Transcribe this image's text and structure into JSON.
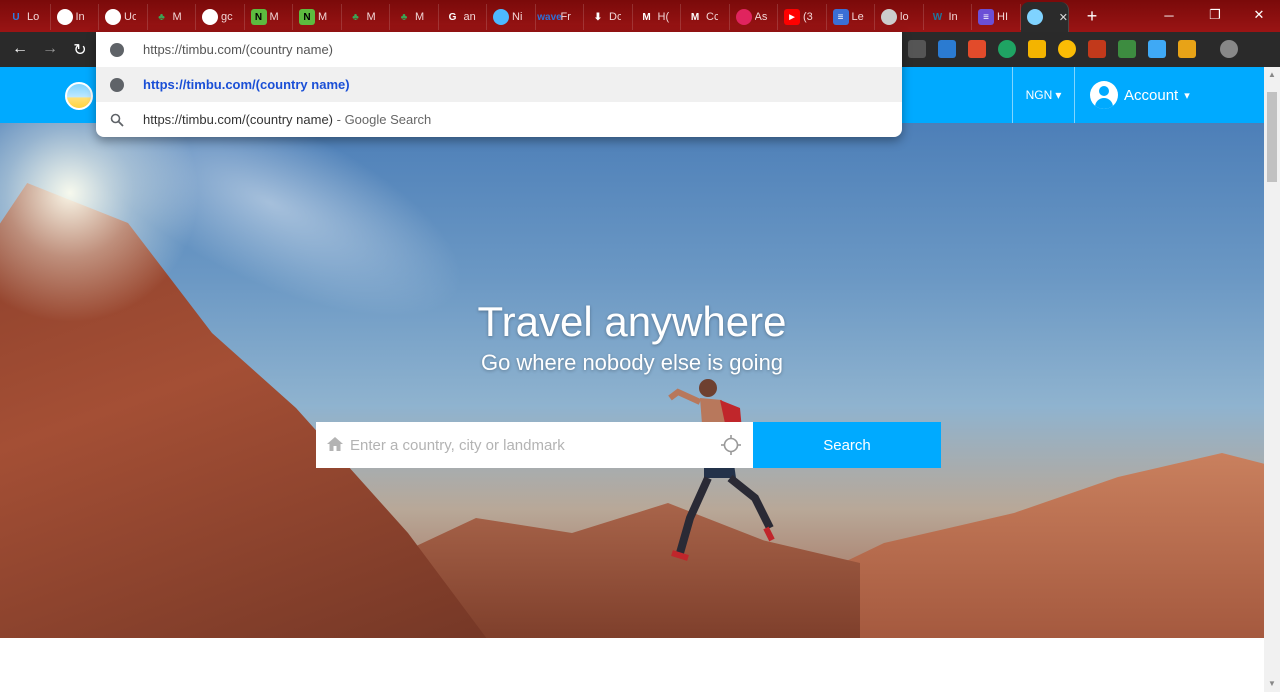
{
  "browser": {
    "tabs": [
      {
        "label": "Lo",
        "icon": "U",
        "color": "#2f7de1"
      },
      {
        "label": "In",
        "icon": "globe",
        "color": "#ffffff"
      },
      {
        "label": "Uc",
        "icon": "globe",
        "color": "#ffffff"
      },
      {
        "label": "M",
        "icon": "leaf",
        "color": "#3aa655"
      },
      {
        "label": "gc",
        "icon": "globe",
        "color": "#ffffff"
      },
      {
        "label": "M",
        "icon": "N",
        "color": "#5dbb3f"
      },
      {
        "label": "M",
        "icon": "N",
        "color": "#5dbb3f"
      },
      {
        "label": "M",
        "icon": "leaf",
        "color": "#3aa655"
      },
      {
        "label": "M",
        "icon": "leaf",
        "color": "#3aa655"
      },
      {
        "label": "an",
        "icon": "G",
        "color": "#ffffff"
      },
      {
        "label": "Ni",
        "icon": "circle",
        "color": "#4db8ff"
      },
      {
        "label": "Fr",
        "icon": "wave",
        "color": "#2e6fd8"
      },
      {
        "label": "Dc",
        "icon": "download",
        "color": "#ffffff"
      },
      {
        "label": "H(",
        "icon": "M",
        "color": "#ffffff"
      },
      {
        "label": "Cc",
        "icon": "M",
        "color": "#ffffff"
      },
      {
        "label": "As",
        "icon": "circle",
        "color": "#e0245e"
      },
      {
        "label": "(3",
        "icon": "play",
        "color": "#ff0000"
      },
      {
        "label": "Le",
        "icon": "doc",
        "color": "#3b6fd6"
      },
      {
        "label": "lo",
        "icon": "globe",
        "color": "#cccccc"
      },
      {
        "label": "In",
        "icon": "W",
        "color": "#21759b"
      },
      {
        "label": "HI",
        "icon": "list",
        "color": "#6b4fd6"
      },
      {
        "label": "",
        "icon": "timbu",
        "color": "#7fd3ff",
        "active": true
      }
    ],
    "new_tab_label": "+",
    "window_controls": {
      "minimize": "─",
      "restore": "❐",
      "close": "✕"
    },
    "nav": {
      "back": "←",
      "forward": "→",
      "reload": "↻"
    },
    "omnibox": {
      "typed_url": "https://timbu.com/(country name)",
      "suggestions": [
        {
          "text": "https://timbu.com/(country name)",
          "suffix": "",
          "icon": "globe-icon"
        },
        {
          "text": "https://timbu.com/(country name)",
          "suffix": " - Google Search",
          "icon": "search-icon"
        }
      ]
    }
  },
  "site": {
    "currency": "NGN",
    "currency_caret": "▾",
    "account_label": "Account",
    "account_caret": "▾",
    "accent_color": "#00aaff",
    "hero": {
      "title": "Travel anywhere",
      "subtitle": "Go where nobody else is going"
    },
    "search": {
      "placeholder": "Enter a country, city or landmark",
      "value": "",
      "button_label": "Search"
    }
  }
}
